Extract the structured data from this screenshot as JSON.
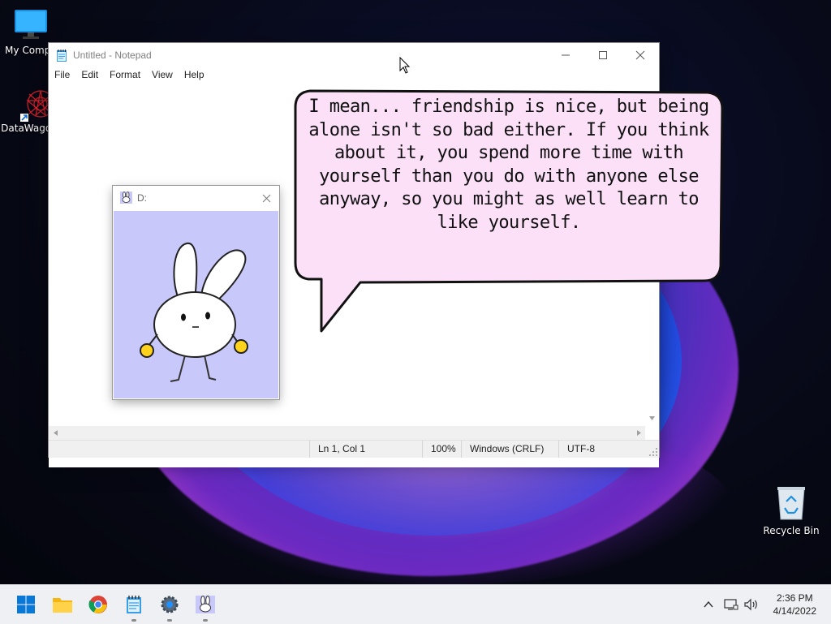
{
  "desktop": {
    "icons": [
      {
        "label": "My Compu",
        "icon": "computer-monitor-icon"
      },
      {
        "label": "DataWagon",
        "icon": "datawagon-shortcut-icon"
      },
      {
        "label": "Recycle Bin",
        "icon": "recycle-bin-icon"
      }
    ]
  },
  "notepad": {
    "title": "Untitled - Notepad",
    "menu": [
      "File",
      "Edit",
      "Format",
      "View",
      "Help"
    ],
    "status": {
      "position": "Ln 1, Col 1",
      "zoom": "100%",
      "line_endings": "Windows (CRLF)",
      "encoding": "UTF-8"
    }
  },
  "companion_window": {
    "title": "D:",
    "icon": "bunny-app-icon",
    "background_color": "#c9c8fb"
  },
  "speech_bubble": {
    "lines": [
      "I mean... friendship is nice, but being",
      "alone isn't so bad either. If you think",
      "about it, you spend more time with",
      "yourself than you do with anyone else",
      "anyway, so you might as well learn to",
      "like yourself."
    ],
    "fill_color": "#fbe0f8"
  },
  "taskbar": {
    "apps": [
      "start-icon",
      "file-explorer-icon",
      "chrome-icon",
      "notepad-icon",
      "settings-icon",
      "bunny-app-icon"
    ],
    "clock": {
      "time": "2:36 PM",
      "date": "4/14/2022"
    }
  }
}
